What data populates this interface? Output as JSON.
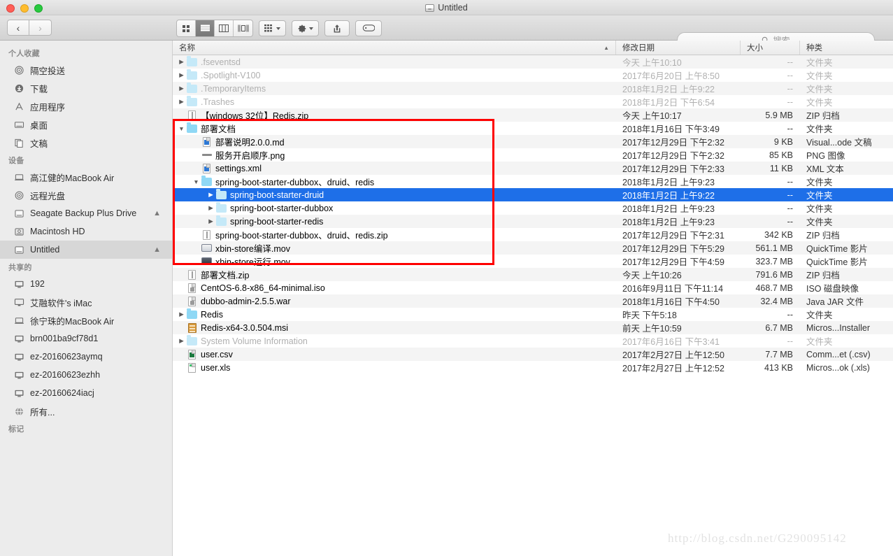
{
  "window": {
    "title": "Untitled",
    "title_icon": "drive-icon",
    "traffic_lights": [
      "close-red",
      "minimize-yellow",
      "zoom-green"
    ]
  },
  "toolbar": {
    "back_label": "‹",
    "forward_label": "›",
    "view_modes": [
      {
        "name": "icon-view",
        "icon": "grid-icon",
        "active": false
      },
      {
        "name": "list-view",
        "icon": "list-icon",
        "active": true
      },
      {
        "name": "column-view",
        "icon": "columns-icon",
        "active": false
      },
      {
        "name": "gallery-view",
        "icon": "gallery-icon",
        "active": false
      }
    ],
    "arrange_icon": "arrange-grid-icon",
    "action_icon": "gear-icon",
    "share_icon": "share-icon",
    "tag_icon": "tag-icon"
  },
  "search": {
    "placeholder": "搜索",
    "icon": "search-icon",
    "value": ""
  },
  "sidebar": {
    "sections": [
      {
        "header": "个人收藏",
        "items": [
          {
            "label": "隔空投送",
            "icon": "airdrop-icon",
            "selected": false,
            "eject": false
          },
          {
            "label": "下载",
            "icon": "downloads-icon",
            "selected": false,
            "eject": false
          },
          {
            "label": "应用程序",
            "icon": "applications-icon",
            "selected": false,
            "eject": false
          },
          {
            "label": "桌面",
            "icon": "desktop-icon",
            "selected": false,
            "eject": false
          },
          {
            "label": "文稿",
            "icon": "documents-icon",
            "selected": false,
            "eject": false
          }
        ]
      },
      {
        "header": "设备",
        "items": [
          {
            "label": "高江健的MacBook Air",
            "icon": "laptop-icon",
            "selected": false,
            "eject": false
          },
          {
            "label": "远程光盘",
            "icon": "disc-icon",
            "selected": false,
            "eject": false
          },
          {
            "label": "Seagate Backup Plus Drive",
            "icon": "external-drive-icon",
            "selected": false,
            "eject": true
          },
          {
            "label": "Macintosh HD",
            "icon": "internal-drive-icon",
            "selected": false,
            "eject": false
          },
          {
            "label": "Untitled",
            "icon": "external-drive-icon",
            "selected": true,
            "eject": true
          }
        ]
      },
      {
        "header": "共享的",
        "items": [
          {
            "label": "192",
            "icon": "server-icon",
            "selected": false,
            "eject": false
          },
          {
            "label": "艾融软件's iMac",
            "icon": "imac-icon",
            "selected": false,
            "eject": false
          },
          {
            "label": "徐宁珠的MacBook Air",
            "icon": "laptop-icon",
            "selected": false,
            "eject": false
          },
          {
            "label": "brn001ba9cf78d1",
            "icon": "server-icon",
            "selected": false,
            "eject": false
          },
          {
            "label": "ez-20160623aymq",
            "icon": "server-icon",
            "selected": false,
            "eject": false
          },
          {
            "label": "ez-20160623ezhh",
            "icon": "server-icon",
            "selected": false,
            "eject": false
          },
          {
            "label": "ez-20160624iacj",
            "icon": "server-icon",
            "selected": false,
            "eject": false
          },
          {
            "label": "所有...",
            "icon": "network-globe-icon",
            "selected": false,
            "eject": false
          }
        ]
      },
      {
        "header": "标记",
        "items": []
      }
    ]
  },
  "file_list": {
    "columns": [
      {
        "label": "名称",
        "sorted": true,
        "sort_dir": "asc"
      },
      {
        "label": "修改日期",
        "sorted": false
      },
      {
        "label": "大小",
        "sorted": false
      },
      {
        "label": "种类",
        "sorted": false
      }
    ],
    "rows": [
      {
        "name": ".fseventsd",
        "date": "今天 上午10:10",
        "size": "--",
        "kind": "文件夹",
        "icon": "folder-pale-icon",
        "twisty": "collapsed",
        "indent": 0,
        "dim": true,
        "selected": false
      },
      {
        "name": ".Spotlight-V100",
        "date": "2017年6月20日 上午8:50",
        "size": "--",
        "kind": "文件夹",
        "icon": "folder-pale-icon",
        "twisty": "collapsed",
        "indent": 0,
        "dim": true,
        "selected": false
      },
      {
        "name": ".TemporaryItems",
        "date": "2018年1月2日 上午9:22",
        "size": "--",
        "kind": "文件夹",
        "icon": "folder-pale-icon",
        "twisty": "collapsed",
        "indent": 0,
        "dim": true,
        "selected": false
      },
      {
        "name": ".Trashes",
        "date": "2018年1月2日 下午6:54",
        "size": "--",
        "kind": "文件夹",
        "icon": "folder-pale-icon",
        "twisty": "collapsed",
        "indent": 0,
        "dim": true,
        "selected": false
      },
      {
        "name": "【windows 32位】Redis.zip",
        "date": "今天 上午10:17",
        "size": "5.9 MB",
        "kind": "ZIP 归档",
        "icon": "zip-icon",
        "twisty": "none",
        "indent": 0,
        "dim": false,
        "selected": false
      },
      {
        "name": "部署文档",
        "date": "2018年1月16日 下午3:49",
        "size": "--",
        "kind": "文件夹",
        "icon": "folder-icon",
        "twisty": "expanded",
        "indent": 0,
        "dim": false,
        "selected": false
      },
      {
        "name": "部署说明2.0.0.md",
        "date": "2017年12月29日 下午2:32",
        "size": "9 KB",
        "kind": "Visual...ode 文稿",
        "icon": "vscode-doc-icon",
        "twisty": "none",
        "indent": 1,
        "dim": false,
        "selected": false
      },
      {
        "name": "服务开启顺序.png",
        "date": "2017年12月29日 下午2:32",
        "size": "85 KB",
        "kind": "PNG 图像",
        "icon": "image-icon",
        "twisty": "none",
        "indent": 1,
        "dim": false,
        "selected": false
      },
      {
        "name": "settings.xml",
        "date": "2017年12月29日 下午2:33",
        "size": "11 KB",
        "kind": "XML 文本",
        "icon": "vscode-doc-icon",
        "twisty": "none",
        "indent": 1,
        "dim": false,
        "selected": false
      },
      {
        "name": "spring-boot-starter-dubbox、druid、redis",
        "date": "2018年1月2日 上午9:23",
        "size": "--",
        "kind": "文件夹",
        "icon": "folder-icon",
        "twisty": "expanded",
        "indent": 1,
        "dim": false,
        "selected": false
      },
      {
        "name": "spring-boot-starter-druid",
        "date": "2018年1月2日 上午9:22",
        "size": "--",
        "kind": "文件夹",
        "icon": "folder-pale-icon",
        "twisty": "collapsed",
        "indent": 2,
        "dim": false,
        "selected": true
      },
      {
        "name": "spring-boot-starter-dubbox",
        "date": "2018年1月2日 上午9:23",
        "size": "--",
        "kind": "文件夹",
        "icon": "folder-pale-icon",
        "twisty": "collapsed",
        "indent": 2,
        "dim": false,
        "selected": false
      },
      {
        "name": "spring-boot-starter-redis",
        "date": "2018年1月2日 上午9:23",
        "size": "--",
        "kind": "文件夹",
        "icon": "folder-pale-icon",
        "twisty": "collapsed",
        "indent": 2,
        "dim": false,
        "selected": false
      },
      {
        "name": "spring-boot-starter-dubbox、druid、redis.zip",
        "date": "2017年12月29日 下午2:31",
        "size": "342 KB",
        "kind": "ZIP 归档",
        "icon": "zip-icon",
        "twisty": "none",
        "indent": 1,
        "dim": false,
        "selected": false
      },
      {
        "name": "xbin-store编译.mov",
        "date": "2017年12月29日 下午5:29",
        "size": "561.1 MB",
        "kind": "QuickTime 影片",
        "icon": "movie-light-icon",
        "twisty": "none",
        "indent": 1,
        "dim": false,
        "selected": false
      },
      {
        "name": "xbin-store运行.mov",
        "date": "2017年12月29日 下午4:59",
        "size": "323.7 MB",
        "kind": "QuickTime 影片",
        "icon": "movie-icon",
        "twisty": "none",
        "indent": 1,
        "dim": false,
        "selected": false
      },
      {
        "name": "部署文档.zip",
        "date": "今天 上午10:26",
        "size": "791.6 MB",
        "kind": "ZIP 归档",
        "icon": "zip-icon",
        "twisty": "none",
        "indent": 0,
        "dim": false,
        "selected": false
      },
      {
        "name": "CentOS-6.8-x86_64-minimal.iso",
        "date": "2016年9月11日 下午11:14",
        "size": "468.7 MB",
        "kind": "ISO 磁盘映像",
        "icon": "iso-icon",
        "twisty": "none",
        "indent": 0,
        "dim": false,
        "selected": false
      },
      {
        "name": "dubbo-admin-2.5.5.war",
        "date": "2018年1月16日 下午4:50",
        "size": "32.4 MB",
        "kind": "Java JAR 文件",
        "icon": "jar-icon",
        "twisty": "none",
        "indent": 0,
        "dim": false,
        "selected": false
      },
      {
        "name": "Redis",
        "date": "昨天 下午5:18",
        "size": "--",
        "kind": "文件夹",
        "icon": "folder-icon",
        "twisty": "collapsed",
        "indent": 0,
        "dim": false,
        "selected": false
      },
      {
        "name": "Redis-x64-3.0.504.msi",
        "date": "前天 上午10:59",
        "size": "6.7 MB",
        "kind": "Micros...Installer",
        "icon": "msi-icon",
        "twisty": "none",
        "indent": 0,
        "dim": false,
        "selected": false
      },
      {
        "name": "System Volume Information",
        "date": "2017年6月16日 下午3:41",
        "size": "--",
        "kind": "文件夹",
        "icon": "folder-pale-icon",
        "twisty": "collapsed",
        "indent": 0,
        "dim": true,
        "selected": false
      },
      {
        "name": "user.csv",
        "date": "2017年2月27日 上午12:50",
        "size": "7.7 MB",
        "kind": "Comm...et (.csv)",
        "icon": "excel-csv-icon",
        "twisty": "none",
        "indent": 0,
        "dim": false,
        "selected": false
      },
      {
        "name": "user.xls",
        "date": "2017年2月27日 上午12:52",
        "size": "413 KB",
        "kind": "Micros...ok (.xls)",
        "icon": "excel-xls-icon",
        "twisty": "none",
        "indent": 0,
        "dim": false,
        "selected": false
      }
    ]
  },
  "annotation": {
    "type": "red-rectangle",
    "color": "#fe0000"
  },
  "watermark": {
    "text": "http://blog.csdn.net/G290095142"
  }
}
